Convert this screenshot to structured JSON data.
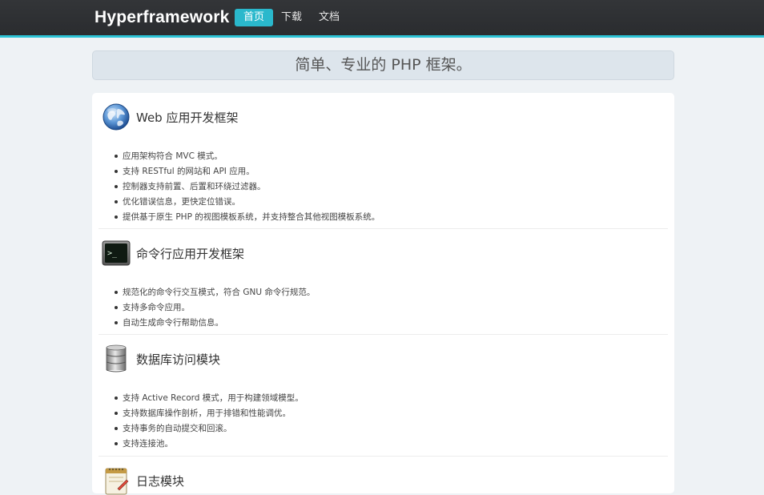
{
  "navbar": {
    "brand": "Hyperframework",
    "items": [
      {
        "label": "首页",
        "active": true
      },
      {
        "label": "下载",
        "active": false
      },
      {
        "label": "文档",
        "active": false
      }
    ],
    "accent_color": "#2ab8cc"
  },
  "banner": {
    "text": "简单、专业的 PHP 框架。"
  },
  "sections": [
    {
      "icon": "globe-icon",
      "title": "Web 应用开发框架",
      "items": [
        "应用架构符合 MVC 模式。",
        "支持 RESTful 的网站和 API 应用。",
        "控制器支持前置、后置和环绕过滤器。",
        "优化错误信息，更快定位错误。",
        "提供基于原生 PHP 的视图模板系统，并支持整合其他视图模板系统。"
      ]
    },
    {
      "icon": "terminal-icon",
      "title": "命令行应用开发框架",
      "items": [
        "规范化的命令行交互模式，符合 GNU 命令行规范。",
        "支持多命令应用。",
        "自动生成命令行帮助信息。"
      ]
    },
    {
      "icon": "database-icon",
      "title": "数据库访问模块",
      "items": [
        "支持 Active Record 模式，用于构建领域模型。",
        "支持数据库操作剖析，用于排错和性能调优。",
        "支持事务的自动提交和回滚。",
        "支持连接池。"
      ]
    },
    {
      "icon": "notepad-icon",
      "title": "日志模块",
      "items": []
    }
  ]
}
